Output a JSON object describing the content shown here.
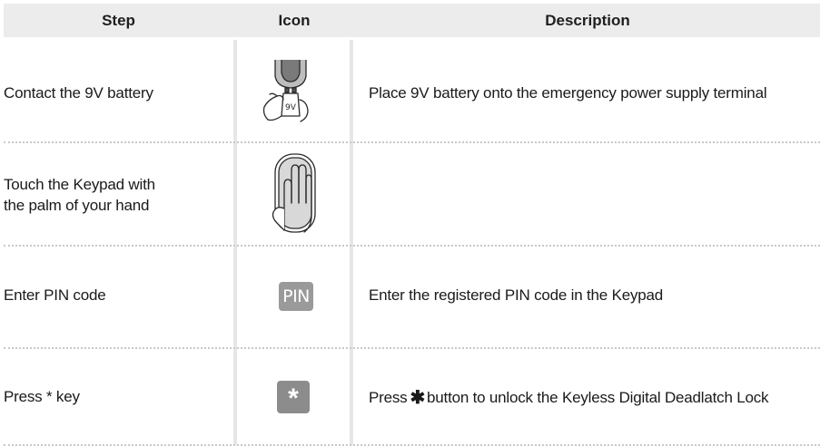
{
  "headers": {
    "step": "Step",
    "icon": "Icon",
    "description": "Description"
  },
  "rows": [
    {
      "step_line1": "Contact the 9V battery",
      "step_line2": "",
      "icon": "battery-hand-icon",
      "icon_text": "9V",
      "description": "Place 9V battery onto the emergency power supply terminal"
    },
    {
      "step_line1": "Touch the Keypad with",
      "step_line2": "the palm of your hand",
      "icon": "palm-touch-icon",
      "description": ""
    },
    {
      "step_line1": "Enter PIN code",
      "step_line2": "",
      "icon": "pin-icon",
      "icon_text": "PIN",
      "description": "Enter the registered PIN code in the Keypad"
    },
    {
      "step_line1": "Press * key",
      "step_line2": "",
      "icon": "star-key-icon",
      "icon_text": "*",
      "description_before": "Press",
      "description_symbol": "✱",
      "description_after": "button to unlock the Keyless Digital Deadlatch Lock"
    }
  ],
  "colors": {
    "header_bg": "#ececec",
    "separator": "#e6e6e6",
    "icon_gray": "#9a9a9a"
  }
}
